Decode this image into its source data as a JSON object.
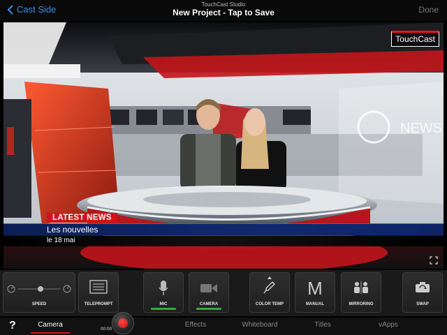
{
  "header": {
    "back_label": "Cast Side",
    "app_name": "TouchCast Studio",
    "project_title": "New Project - Tap to Save",
    "done_label": "Done"
  },
  "preview": {
    "brand": "TouchCast",
    "lower_third": {
      "tag": "LATEST NEWS",
      "headline": "Les nouvelles",
      "date": "le 18 mai"
    },
    "backdrop_sign": "NEWS"
  },
  "controls": [
    {
      "id": "speed",
      "label": "SPEED",
      "icon": "slider-icon",
      "active": false
    },
    {
      "id": "teleprompt",
      "label": "TELEPROMPT",
      "icon": "teleprompter-icon",
      "active": false
    },
    {
      "id": "mic",
      "label": "MIC",
      "icon": "microphone-icon",
      "active": true
    },
    {
      "id": "camera",
      "label": "CAMERA",
      "icon": "video-camera-icon",
      "active": true
    },
    {
      "id": "color_temp",
      "label": "COLOR TEMP",
      "icon": "dropper-icon",
      "active": false
    },
    {
      "id": "manual",
      "label": "MANUAL",
      "icon": "manual-m-icon",
      "active": false
    },
    {
      "id": "mirroring",
      "label": "MIRRORING",
      "icon": "mirror-people-icon",
      "active": false
    },
    {
      "id": "swap",
      "label": "SWAP",
      "icon": "swap-camera-icon",
      "active": false
    }
  ],
  "manual_glyph": "M",
  "tabbar": {
    "help": "?",
    "timer": "00:00",
    "tabs": [
      "Camera",
      "Effects",
      "Whiteboard",
      "Titles",
      "vApps"
    ],
    "active_tab": "Camera"
  },
  "colors": {
    "accent_blue": "#3a8ee6",
    "news_red": "#d01418",
    "active_green": "#2fae3a"
  }
}
